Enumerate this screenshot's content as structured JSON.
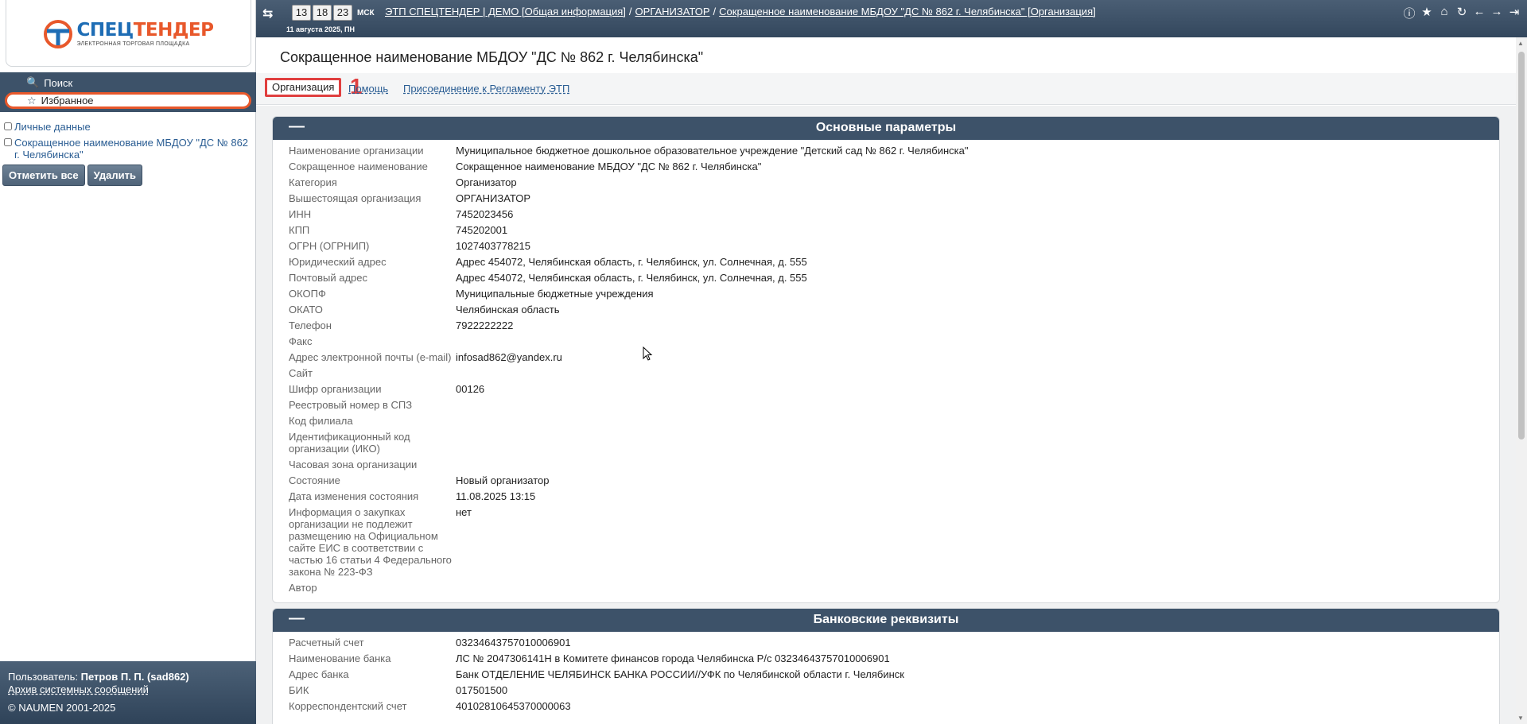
{
  "logo": {
    "name_part1": "СПЕЦ",
    "name_part2": "ТЕНДЕР",
    "subtitle": "ЭЛЕКТРОННАЯ ТОРГОВАЯ ПЛОЩАДКА",
    "colors": {
      "blue": "#1e6db5",
      "orange": "#e8582b"
    }
  },
  "nav": {
    "search_label": "Поиск",
    "favorites_label": "Избранное"
  },
  "favorites": {
    "items": [
      {
        "label": "Личные данные"
      },
      {
        "label": "Сокращенное наименование МБДОУ \"ДС № 862 г. Челябинска\""
      }
    ],
    "select_all_label": "Отметить все",
    "delete_label": "Удалить"
  },
  "footer": {
    "user_prefix": "Пользователь: ",
    "user_name": "Петров П. П. (sad862)",
    "archive_link": "Архив системных сообщений",
    "copyright": "© NAUMEN 2001-2025"
  },
  "topbar": {
    "clock": {
      "hours": "13",
      "minutes": "18",
      "seconds": "23",
      "timezone": "МСК",
      "date": "11 августа 2025, ПН"
    },
    "breadcrumbs": [
      "ЭТП СПЕЦТЕНДЕР | ДЕМО [Общая информация]",
      "ОРГАНИЗАТОР",
      "Сокращенное наименование МБДОУ \"ДС № 862 г. Челябинска\" [Организация]"
    ],
    "icons": [
      "help-icon",
      "star-icon",
      "home-icon",
      "refresh-icon",
      "back-icon",
      "forward-icon",
      "logout-icon"
    ]
  },
  "page": {
    "title": "Сокращенное наименование МБДОУ \"ДС № 862 г. Челябинска\"",
    "tabs": [
      {
        "label": "Организация",
        "active": true
      },
      {
        "label": "Помощь"
      },
      {
        "label": "Присоединение к Регламенту ЭТП"
      }
    ],
    "annotation_number": "1"
  },
  "sections": {
    "main": {
      "title": "Основные параметры",
      "collapse_symbol": "—",
      "rows": [
        {
          "label": "Наименование организации",
          "value": "Муниципальное бюджетное дошкольное образовательное учреждение \"Детский сад № 862 г. Челябинска\""
        },
        {
          "label": "Сокращенное наименование",
          "value": "Сокращенное наименование МБДОУ \"ДС № 862 г. Челябинска\""
        },
        {
          "label": "Категория",
          "value": "Организатор"
        },
        {
          "label": "Вышестоящая организация",
          "value": "ОРГАНИЗАТОР"
        },
        {
          "label": "ИНН",
          "value": "7452023456"
        },
        {
          "label": "КПП",
          "value": "745202001"
        },
        {
          "label": "ОГРН (ОГРНИП)",
          "value": "1027403778215"
        },
        {
          "label": "Юридический адрес",
          "value": "Адрес 454072, Челябинская область, г. Челябинск, ул. Солнечная, д. 555"
        },
        {
          "label": "Почтовый адрес",
          "value": "Адрес 454072, Челябинская область, г. Челябинск, ул. Солнечная, д. 555"
        },
        {
          "label": "ОКОПФ",
          "value": "Муниципальные бюджетные учреждения"
        },
        {
          "label": "ОКАТО",
          "value": "Челябинская область"
        },
        {
          "label": "Телефон",
          "value": "7922222222"
        },
        {
          "label": "Факс",
          "value": ""
        },
        {
          "label": "Адрес электронной почты (e-mail)",
          "value": "infosad862@yandex.ru"
        },
        {
          "label": "Сайт",
          "value": ""
        },
        {
          "label": "Шифр организации",
          "value": "00126"
        },
        {
          "label": "Реестровый номер в СПЗ",
          "value": ""
        },
        {
          "label": "Код филиала",
          "value": ""
        },
        {
          "label": "Идентификационный код организации (ИКО)",
          "value": ""
        },
        {
          "label": "Часовая зона организации",
          "value": ""
        },
        {
          "label": "Состояние",
          "value": "Новый организатор"
        },
        {
          "label": "Дата изменения состояния",
          "value": "11.08.2025 13:15"
        },
        {
          "label": "Информация о закупках организации не подлежит размещению на Официальном сайте ЕИС в соответствии с частью 16 статьи 4 Федерального закона № 223-ФЗ",
          "value": "нет"
        },
        {
          "label": "Автор",
          "value": ""
        }
      ]
    },
    "bank": {
      "title": "Банковские реквизиты",
      "collapse_symbol": "—",
      "rows": [
        {
          "label": "Расчетный счет",
          "value": "03234643757010006901"
        },
        {
          "label": "Наименование банка",
          "value": "ЛС № 2047306141Н в Комитете финансов города Челябинска Р/с 03234643757010006901"
        },
        {
          "label": "Адрес банка",
          "value": "Банк ОТДЕЛЕНИЕ ЧЕЛЯБИНСК БАНКА РОССИИ//УФК по Челябинской области г. Челябинск"
        },
        {
          "label": "БИК",
          "value": "017501500"
        },
        {
          "label": "Корреспондентский счет",
          "value": "40102810645370000063"
        }
      ]
    }
  }
}
